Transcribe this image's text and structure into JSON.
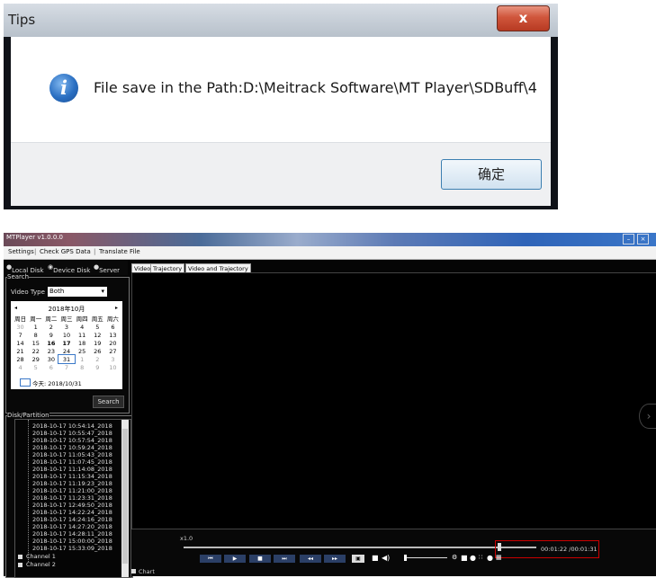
{
  "dialog": {
    "title": "Tips",
    "close_glyph": "x",
    "info_glyph": "i",
    "message": "File save in the Path:D:\\Meitrack Software\\MT Player\\SDBuff\\4",
    "ok_label": "确定"
  },
  "player": {
    "window_title": "MTPlayer v1.0.0.0",
    "window_buttons": [
      "–",
      "×"
    ],
    "menu": [
      "Settings",
      "Check GPS Data",
      "Translate File"
    ],
    "sources": [
      "Local Disk",
      "Device Disk",
      "Server"
    ],
    "search": {
      "legend": "Search",
      "video_type_label": "Video Type",
      "video_type_value": "Both",
      "button": "Search"
    },
    "calendar": {
      "month": "2018年10月",
      "weekdays": [
        "周日",
        "周一",
        "周二",
        "周三",
        "周四",
        "周五",
        "周六"
      ],
      "weeks": [
        [
          "30",
          "1",
          "2",
          "3",
          "4",
          "5",
          "6"
        ],
        [
          "7",
          "8",
          "9",
          "10",
          "11",
          "12",
          "13"
        ],
        [
          "14",
          "15",
          "16",
          "17",
          "18",
          "19",
          "20"
        ],
        [
          "21",
          "22",
          "23",
          "24",
          "25",
          "26",
          "27"
        ],
        [
          "28",
          "29",
          "30",
          "31",
          "1",
          "2",
          "3"
        ],
        [
          "4",
          "5",
          "6",
          "7",
          "8",
          "9",
          "10"
        ]
      ],
      "today_label": "今天: 2018/10/31"
    },
    "disk_legend": "Disk/Partition",
    "files": [
      "2018-10-17 10:54:14_2018",
      "2018-10-17 10:55:47_2018",
      "2018-10-17 10:57:54_2018",
      "2018-10-17 10:59:24_2018",
      "2018-10-17 11:05:43_2018",
      "2018-10-17 11:07:45_2018",
      "2018-10-17 11:14:08_2018",
      "2018-10-17 11:15:34_2018",
      "2018-10-17 11:19:23_2018",
      "2018-10-17 11:21:00_2018",
      "2018-10-17 11:23:31_2018",
      "2018-10-17 12:49:50_2018",
      "2018-10-17 14:22:24_2018",
      "2018-10-17 14:24:16_2018",
      "2018-10-17 14:27:20_2018",
      "2018-10-17 14:28:11_2018",
      "2018-10-17 15:00:00_2018",
      "2018-10-17 15:33:09_2018"
    ],
    "channels": [
      "Channel 1",
      "Channel 2"
    ],
    "tabs": [
      "Video",
      "Trajectory",
      "Video and Trajectory"
    ],
    "speed": "x1.0",
    "time": "00:01:22 /00:01:31",
    "chart_label": "Chart"
  }
}
